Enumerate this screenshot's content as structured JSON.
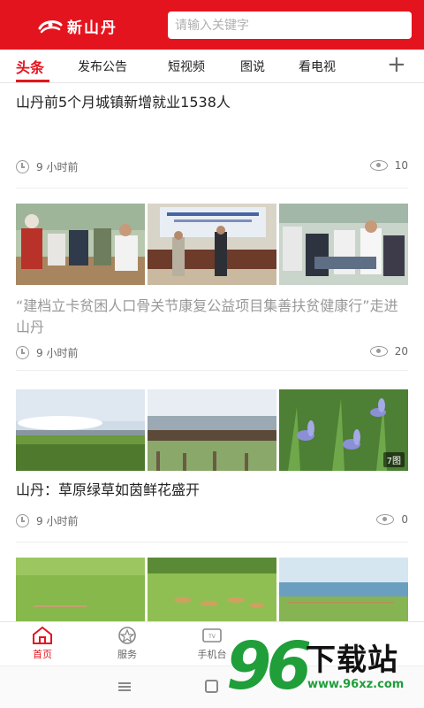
{
  "header": {
    "logo_text": "新山丹",
    "search_placeholder": "请输入关键字"
  },
  "tabs": [
    {
      "label": "头条",
      "active": true
    },
    {
      "label": "发布公告"
    },
    {
      "label": "短视频"
    },
    {
      "label": "图说"
    },
    {
      "label": "看电视"
    }
  ],
  "tab_add_icon": "plus-icon",
  "articles": [
    {
      "title": "山丹前5个月城镇新增就业1538人",
      "time": "9 小时前",
      "views": "10"
    },
    {
      "title": "“建档立卡贫困人口骨关节康复公益项目集善扶贫健康行”走进山丹",
      "time": "9 小时前",
      "views": "20"
    },
    {
      "title": "山丹：草原绿草如茵鲜花盛开",
      "time": "9 小时前",
      "views": "0",
      "image_count_badge": "7图"
    }
  ],
  "bottom_nav": [
    {
      "label": "首页",
      "icon": "home-icon",
      "active": true
    },
    {
      "label": "服务",
      "icon": "service-icon"
    },
    {
      "label": "手机台",
      "icon": "tv-icon"
    }
  ],
  "watermark": {
    "logo": "96",
    "text": "下载站",
    "url": "www.96xz.com"
  },
  "colors": {
    "brand": "#e4141e",
    "watermark_green": "#1f9e3a"
  }
}
